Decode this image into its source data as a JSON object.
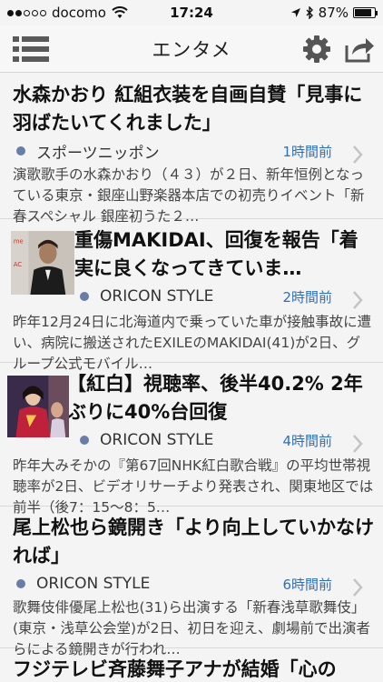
{
  "status_bar": {
    "carrier": "docomo",
    "time": "17:24",
    "battery": "87%",
    "battery_level": 0.87,
    "signal_bars_filled": 2,
    "signal_bars_total": 5
  },
  "nav": {
    "title": "エンタメ",
    "menu_icon": "list-menu-icon",
    "settings_icon": "gear-icon",
    "share_icon": "share-icon"
  },
  "colors": {
    "accent_time": "#2d6fc3",
    "source_dot": "#6a7ca8"
  },
  "articles": [
    {
      "title": "水森かおり 紅組衣装を自画自賛「見事に羽ばたいてくれました」",
      "source": "スポーツニッポン",
      "time": "1時間前",
      "snippet": "演歌歌手の水森かおり（４３）が２日、新年恒例となっている東京・銀座山野楽器本店での初売りイベント「新春スペシャル 銀座初うた２…",
      "has_thumbnail": false
    },
    {
      "title": "重傷MAKIDAI、回復を報告「着実に良くなってきていま…",
      "source": "ORICON STYLE",
      "time": "2時間前",
      "snippet": "昨年12月24日に北海道内で乗っていた車が接触事故に遭い、病院に搬送されたEXILEのMAKIDAI(41)が2日、グループ公式モバイル…",
      "has_thumbnail": true
    },
    {
      "title": "【紅白】視聴率、後半40.2% 2年ぶりに40%台回復",
      "source": "ORICON STYLE",
      "time": "4時間前",
      "snippet": "昨年大みそかの『第67回NHK紅白歌合戦』の平均世帯視聴率が2日、ビデオリサーチより発表され、関東地区では前半（後7：15〜8：5…",
      "has_thumbnail": true
    },
    {
      "title": "尾上松也ら鏡開き「より向上していかなければ」",
      "source": "ORICON STYLE",
      "time": "6時間前",
      "snippet": "歌舞伎俳優尾上松也(31)ら出演する「新春浅草歌舞伎」(東京・浅草公会堂)が2日、初日を迎え、劇場前で出演者らによる鏡開きが行われ…",
      "has_thumbnail": false
    },
    {
      "title": "フジテレビ斉藤舞子アナが結婚「心の",
      "has_thumbnail": false
    }
  ]
}
